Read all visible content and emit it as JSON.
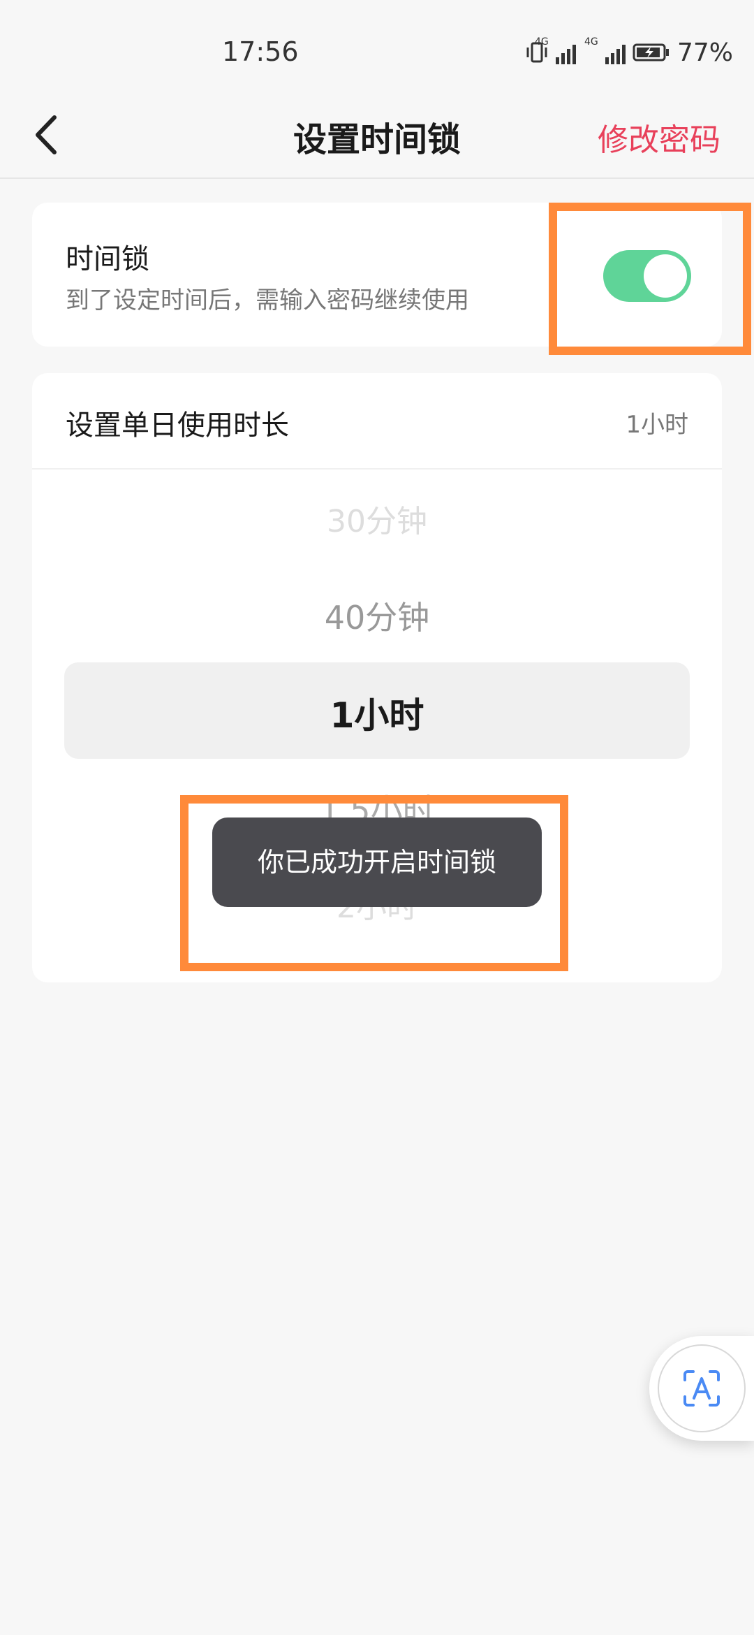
{
  "status_bar": {
    "time": "17:56",
    "net1": "4G",
    "net2": "4G",
    "battery": "77%"
  },
  "nav": {
    "title": "设置时间锁",
    "action": "修改密码",
    "action_color": "#e8405a"
  },
  "time_lock": {
    "title": "时间锁",
    "description": "到了设定时间后，需输入密码继续使用",
    "enabled": true,
    "toggle_color": "#5fd498"
  },
  "duration": {
    "title": "设置单日使用时长",
    "value": "1小时",
    "options": [
      "30分钟",
      "40分钟",
      "1小时",
      "1.5小时",
      "2小时"
    ],
    "selected_index": 2
  },
  "toast": {
    "message": "你已成功开启时间锁"
  },
  "highlight_color": "#ff8a3a",
  "float_button_icon": "text-recognition-icon"
}
